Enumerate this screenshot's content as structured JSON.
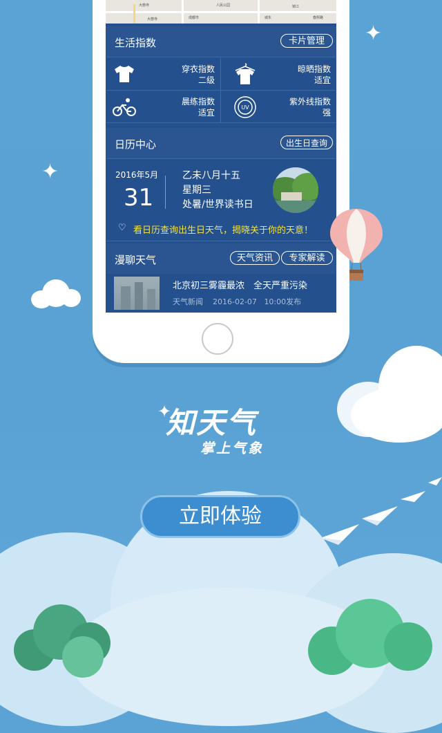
{
  "app": {
    "title": "知天气",
    "subtitle": "掌上气象",
    "cta_label": "立即体验"
  },
  "map": {
    "labels": [
      "大慈寺",
      "成都市",
      "人民公园",
      "城东",
      "锦江",
      "大慈寺",
      "春熙路"
    ]
  },
  "life_index": {
    "title": "生活指数",
    "manage_button": "卡片管理",
    "items": [
      {
        "name": "穿衣指数",
        "value": "二级",
        "icon": "tshirt-icon"
      },
      {
        "name": "晾晒指数",
        "value": "适宜",
        "icon": "hanger-shirt-icon"
      },
      {
        "name": "晨练指数",
        "value": "适宜",
        "icon": "bicycle-icon"
      },
      {
        "name": "紫外线指数",
        "value": "强",
        "icon": "uv-icon"
      }
    ]
  },
  "calendar": {
    "title": "日历中心",
    "birthday_button": "出生日查询",
    "year_month": "2016年5月",
    "day": "31",
    "lunar": "乙未八月十五",
    "weekday": "星期三",
    "events": "处暑/世界读书日",
    "promo": "看日历查询出生日天气，揭晓关于你的天意！"
  },
  "chat": {
    "title": "漫聊天气",
    "tabs": [
      "天气资讯",
      "专家解读"
    ],
    "news": {
      "headline": "北京初三雾霾最浓　全天严重污染",
      "source": "天气新闻",
      "date": "2016-02-07",
      "time": "10:00发布"
    }
  },
  "colors": {
    "sky": "#5aa3d5",
    "screen": "#24508e",
    "accent_yellow": "#f3e34a",
    "cta": "#3d8ed1"
  }
}
